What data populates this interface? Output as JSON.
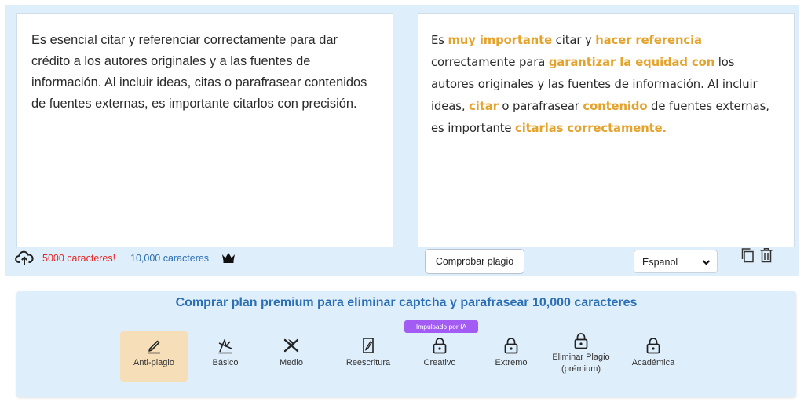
{
  "input": {
    "text": "Es esencial citar y referenciar correctamente para dar crédito a los autores originales y a las fuentes de información. Al incluir ideas, citas o parafrasear contenidos de fuentes externas, es importante citarlos con precisión."
  },
  "output": {
    "segments": [
      {
        "t": "Es ",
        "h": false
      },
      {
        "t": "muy importante",
        "h": true
      },
      {
        "t": " citar y ",
        "h": false
      },
      {
        "t": "hacer referencia",
        "h": true
      },
      {
        "t": " correctamente para ",
        "h": false
      },
      {
        "t": "garantizar la equidad con",
        "h": true
      },
      {
        "t": " los autores originales y las fuentes de información. Al incluir ideas, ",
        "h": false
      },
      {
        "t": "citar",
        "h": true
      },
      {
        "t": " o parafrasear ",
        "h": false
      },
      {
        "t": "contenido",
        "h": true
      },
      {
        "t": " de fuentes externas, es importante ",
        "h": false
      },
      {
        "t": "citarlas correctamente.",
        "h": true
      }
    ]
  },
  "counter": {
    "free_limit": "5000 caracteres!",
    "premium_limit": "10,000 caracteres"
  },
  "toolbar": {
    "check_plagiarism_label": "Comprobar plagio",
    "language": "Espanol"
  },
  "premium": {
    "promo_text": "Comprar plan premium para eliminar captcha y parafrasear 10,000 caracteres",
    "ai_badge": "Impulsado por IA"
  },
  "modes": [
    {
      "label": "Anti-plagio",
      "icon": "pen-icon",
      "active": true
    },
    {
      "label": "Básico",
      "icon": "crossed-pen-icon",
      "active": false
    },
    {
      "label": "Medio",
      "icon": "feather-cross-icon",
      "active": false
    },
    {
      "label": "Reescritura",
      "icon": "document-edit-icon",
      "active": false
    },
    {
      "label": "Creativo",
      "icon": "lock-icon",
      "active": false
    },
    {
      "label": "Extremo",
      "icon": "lock-icon",
      "active": false
    },
    {
      "label": "Eliminar Plagio (prémium)",
      "icon": "lock-icon",
      "active": false
    },
    {
      "label": "Académica",
      "icon": "lock-icon",
      "active": false
    }
  ],
  "colors": {
    "highlight": "#e4a32d",
    "panel_bg": "#dfeefb",
    "accent_blue": "#2b6fb5",
    "active_mode_bg": "#f6dfb8",
    "badge_purple": "#a25cf3"
  }
}
